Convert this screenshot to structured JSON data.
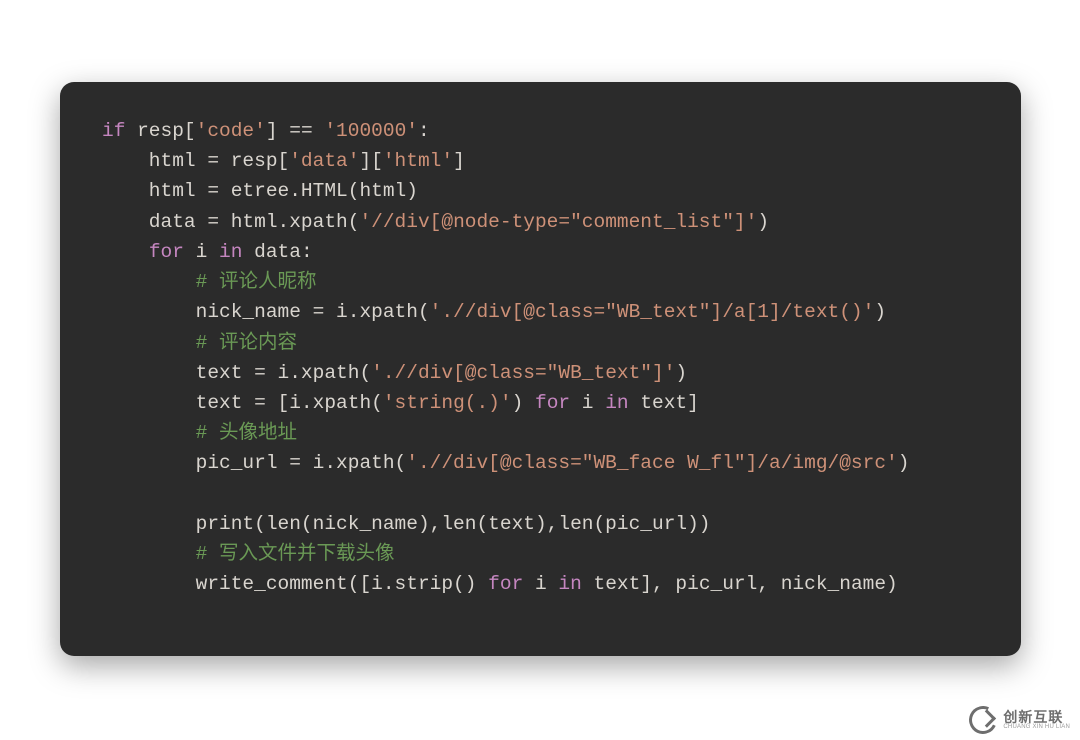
{
  "code": {
    "lines": [
      [
        {
          "cls": "tok-kw",
          "t": "if"
        },
        {
          "cls": "tok-ident",
          "t": " resp["
        },
        {
          "cls": "tok-str",
          "t": "'code'"
        },
        {
          "cls": "tok-ident",
          "t": "] == "
        },
        {
          "cls": "tok-str",
          "t": "'100000'"
        },
        {
          "cls": "tok-ident",
          "t": ":"
        }
      ],
      [
        {
          "cls": "tok-ident",
          "t": "    html = resp["
        },
        {
          "cls": "tok-str",
          "t": "'data'"
        },
        {
          "cls": "tok-ident",
          "t": "]["
        },
        {
          "cls": "tok-str",
          "t": "'html'"
        },
        {
          "cls": "tok-ident",
          "t": "]"
        }
      ],
      [
        {
          "cls": "tok-ident",
          "t": "    html = etree.HTML(html)"
        }
      ],
      [
        {
          "cls": "tok-ident",
          "t": "    data = html.xpath("
        },
        {
          "cls": "tok-str",
          "t": "'//div[@node-type=\"comment_list\"]'"
        },
        {
          "cls": "tok-ident",
          "t": ")"
        }
      ],
      [
        {
          "cls": "tok-ident",
          "t": "    "
        },
        {
          "cls": "tok-kw",
          "t": "for"
        },
        {
          "cls": "tok-ident",
          "t": " i "
        },
        {
          "cls": "tok-kw",
          "t": "in"
        },
        {
          "cls": "tok-ident",
          "t": " data:"
        }
      ],
      [
        {
          "cls": "tok-ident",
          "t": "        "
        },
        {
          "cls": "tok-comment",
          "t": "# 评论人昵称"
        }
      ],
      [
        {
          "cls": "tok-ident",
          "t": "        nick_name = i.xpath("
        },
        {
          "cls": "tok-str",
          "t": "'.//div[@class=\"WB_text\"]/a[1]/text()'"
        },
        {
          "cls": "tok-ident",
          "t": ")"
        }
      ],
      [
        {
          "cls": "tok-ident",
          "t": "        "
        },
        {
          "cls": "tok-comment",
          "t": "# 评论内容"
        }
      ],
      [
        {
          "cls": "tok-ident",
          "t": "        text = i.xpath("
        },
        {
          "cls": "tok-str",
          "t": "'.//div[@class=\"WB_text\"]'"
        },
        {
          "cls": "tok-ident",
          "t": ")"
        }
      ],
      [
        {
          "cls": "tok-ident",
          "t": "        text = [i.xpath("
        },
        {
          "cls": "tok-str",
          "t": "'string(.)'"
        },
        {
          "cls": "tok-ident",
          "t": ") "
        },
        {
          "cls": "tok-kw",
          "t": "for"
        },
        {
          "cls": "tok-ident",
          "t": " i "
        },
        {
          "cls": "tok-kw",
          "t": "in"
        },
        {
          "cls": "tok-ident",
          "t": " text]"
        }
      ],
      [
        {
          "cls": "tok-ident",
          "t": "        "
        },
        {
          "cls": "tok-comment",
          "t": "# 头像地址"
        }
      ],
      [
        {
          "cls": "tok-ident",
          "t": "        pic_url = i.xpath("
        },
        {
          "cls": "tok-str",
          "t": "'.//div[@class=\"WB_face W_fl\"]/a/img/@src'"
        },
        {
          "cls": "tok-ident",
          "t": ")"
        }
      ],
      [
        {
          "cls": "tok-ident",
          "t": ""
        }
      ],
      [
        {
          "cls": "tok-ident",
          "t": "        print(len(nick_name),len(text),len(pic_url))"
        }
      ],
      [
        {
          "cls": "tok-ident",
          "t": "        "
        },
        {
          "cls": "tok-comment",
          "t": "# 写入文件并下载头像"
        }
      ],
      [
        {
          "cls": "tok-ident",
          "t": "        write_comment([i.strip() "
        },
        {
          "cls": "tok-kw",
          "t": "for"
        },
        {
          "cls": "tok-ident",
          "t": " i "
        },
        {
          "cls": "tok-kw",
          "t": "in"
        },
        {
          "cls": "tok-ident",
          "t": " text], pic_url, nick_name)"
        }
      ]
    ]
  },
  "watermark": {
    "zh": "创新互联",
    "py": "CHUANG XIN HU LIAN"
  }
}
